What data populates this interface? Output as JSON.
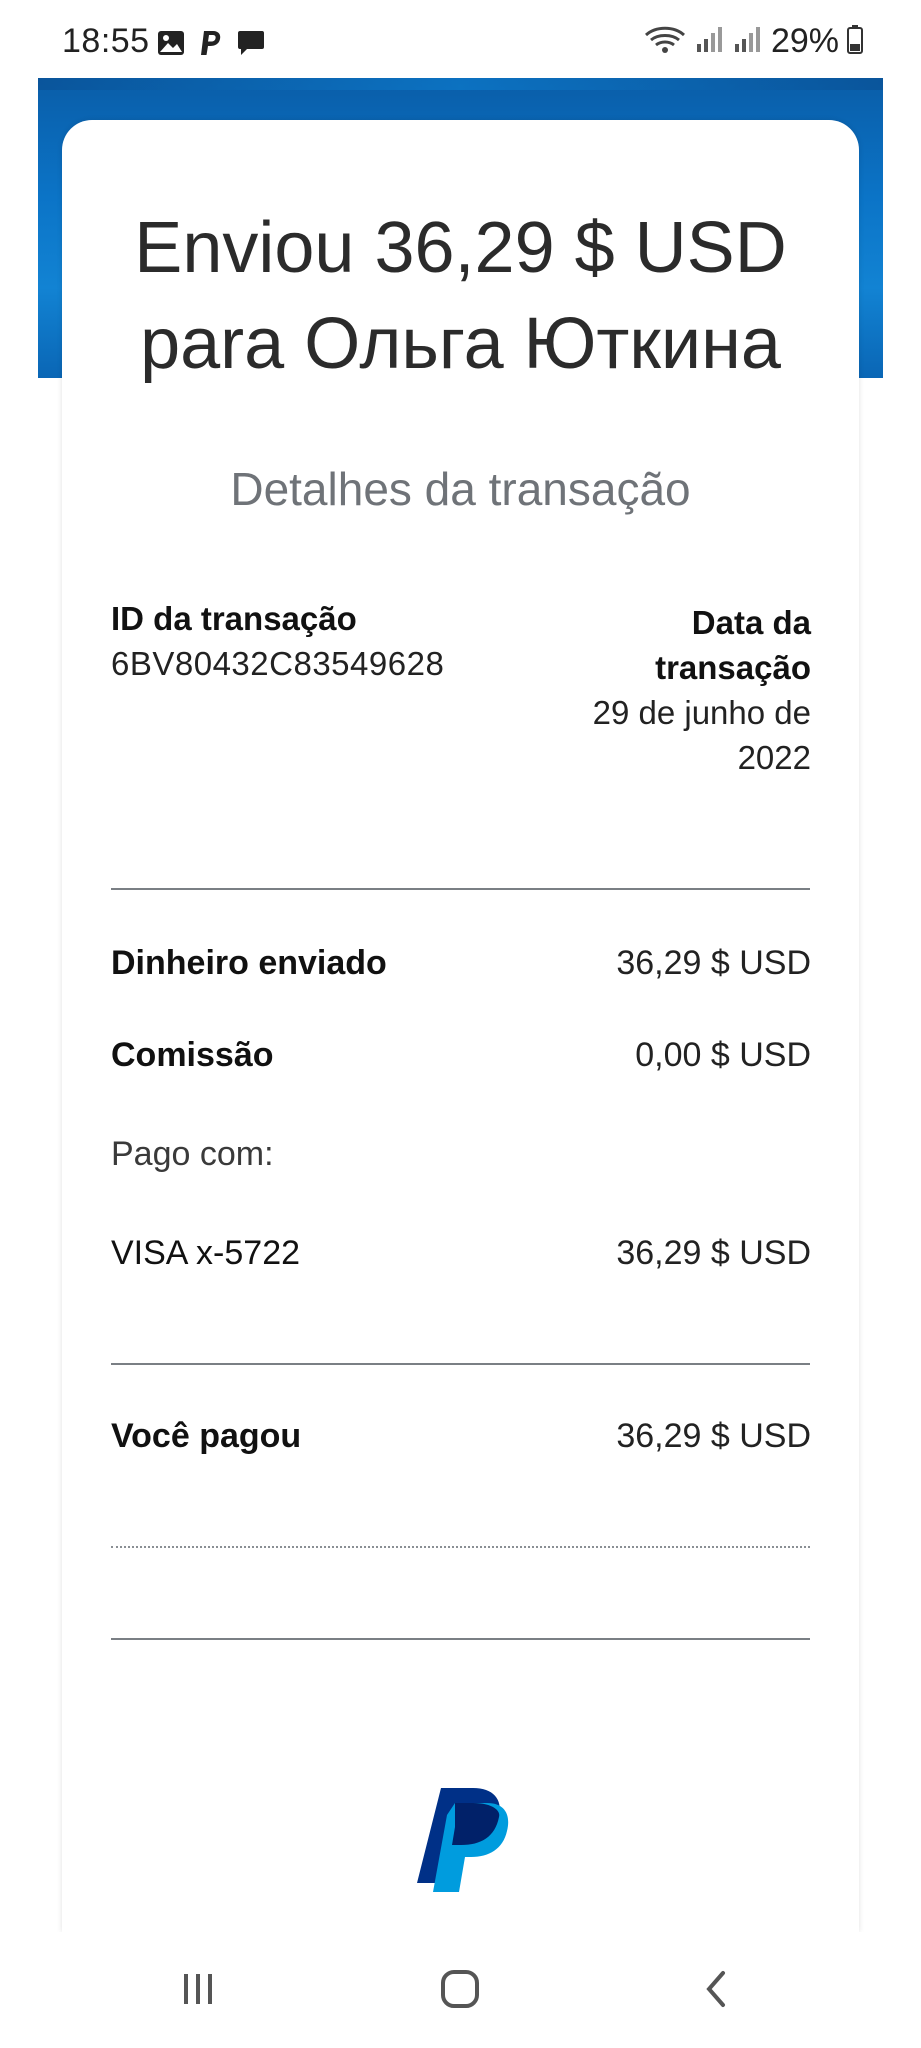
{
  "status_bar": {
    "time": "18:55",
    "left_icons": [
      "gallery-icon",
      "paypal-notification-icon",
      "message-icon"
    ],
    "right_icons": [
      "wifi-icon",
      "signal-icon",
      "signal-icon"
    ],
    "battery": "29%"
  },
  "transaction": {
    "headline_line1": "Enviou 36,29 $ USD",
    "headline_line2": "para Ольга Юткина",
    "section_title": "Detalhes da transação",
    "id_label": "ID da transação",
    "id_value": "6BV80432C83549628",
    "date_label_line1": "Data da",
    "date_label_line2": "transação",
    "date_value_line1": "29 de junho de",
    "date_value_line2": "2022"
  },
  "rows": {
    "sent_label": "Dinheiro enviado",
    "sent_value": "36,29 $ USD",
    "fee_label": "Comissão",
    "fee_value": "0,00 $ USD",
    "paid_with_label": "Pago com:",
    "card_label": "VISA x-5722",
    "card_value": "36,29 $ USD",
    "total_label": "Você pagou",
    "total_value": "36,29 $ USD"
  },
  "colors": {
    "header_blue": "#0b74c7",
    "paypal_dark": "#003087",
    "paypal_light": "#009cde"
  },
  "nav_bar": {
    "items": [
      "recent-apps-icon",
      "home-icon",
      "back-icon"
    ]
  }
}
